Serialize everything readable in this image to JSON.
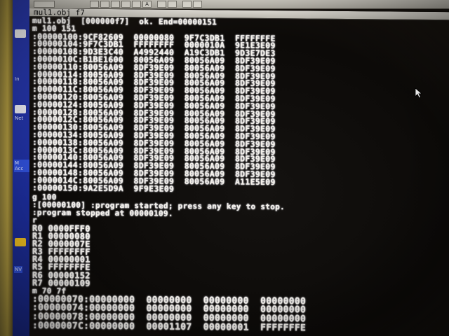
{
  "window": {
    "title": "mul1.obj f7"
  },
  "side_panel": {
    "labels": [
      "In",
      "Net",
      "M Acc",
      "NV"
    ]
  },
  "terminal": {
    "load_line": "mul1.obj  [000000f7]  ok. End=00000151",
    "dump_command": "m 100 151",
    "dump_rows": [
      ":00000100:9CF82609  00000080  9F7C3DB1  FFFFFFFE",
      ":00000104:9F7C3DB1  FFFFFFFF  0000010A  9E1E3E09",
      ":00000108:9D3E3C40  A4992440  A19C3DB1  9D3E7DE3",
      ":0000010C:B1BE1600  80056A09  80056A09  8DF39E09",
      ":00000110:80056A09  8DF39E09  80056A09  8DF39E09",
      ":00000114:80056A09  8DF39E09  80056A09  8DF39E09",
      ":00000118:80056A09  8DF39E09  80056A09  8DF39E09",
      ":0000011C:80056A09  8DF39E09  80056A09  8DF39E09",
      ":00000120:80056A09  8DF39E09  80056A09  8DF39E09",
      ":00000124:80056A09  8DF39E09  80056A09  8DF39E09",
      ":00000128:80056A09  8DF39E09  80056A09  8DF39E09",
      ":0000012C:80056A09  8DF39E09  80056A09  8DF39E09",
      ":00000130:80056A09  8DF39E09  80056A09  8DF39E09",
      ":00000134:80056A09  8DF39E09  80056A09  8DF39E09",
      ":00000138:80056A09  8DF39E09  80056A09  8DF39E09",
      ":0000013C:80056A09  8DF39E09  80056A09  8DF39E09",
      ":00000140:80056A09  8DF39E09  80056A09  8DF39E09",
      ":00000144:80056A09  8DF39E09  80056A09  8DF39E09",
      ":00000148:80056A09  8DF39E09  80056A09  8DF39E09",
      ":0000014C:80056A09  8DF39E09  80056A09  A11E5E09",
      ":00000150:9A2E5D9A  9F9E3E09"
    ],
    "go_command": "g 100",
    "start_message": ":[00000100] :program started; press any key to stop.",
    "stop_message": ":program stopped at 00000109.",
    "reg_command": "r",
    "registers": [
      "R0 0000FFF0",
      "R1 00000080",
      "R2 0000007E",
      "R3 FFFFFFFF",
      "R4 00000001",
      "R5 FFFFFFFE",
      "R6 00000152",
      "R7 00000109"
    ],
    "mem_command": "m 70 7f",
    "mem_rows": [
      ":00000070:00000000  00000000  00000000  00000000",
      ":00000074:00000000  00000000  00000000  00000000",
      ":00000078:00000000  00000000  00000000  00000000",
      ":0000007C:00000000  00001107  00000001  FFFFFFFE"
    ]
  },
  "colors": {
    "terminal_text": "#f4f1ea",
    "terminal_bg": "#0c0a08",
    "side_panel": "#1c2d9c",
    "toolbar": "#c9c6bd"
  }
}
